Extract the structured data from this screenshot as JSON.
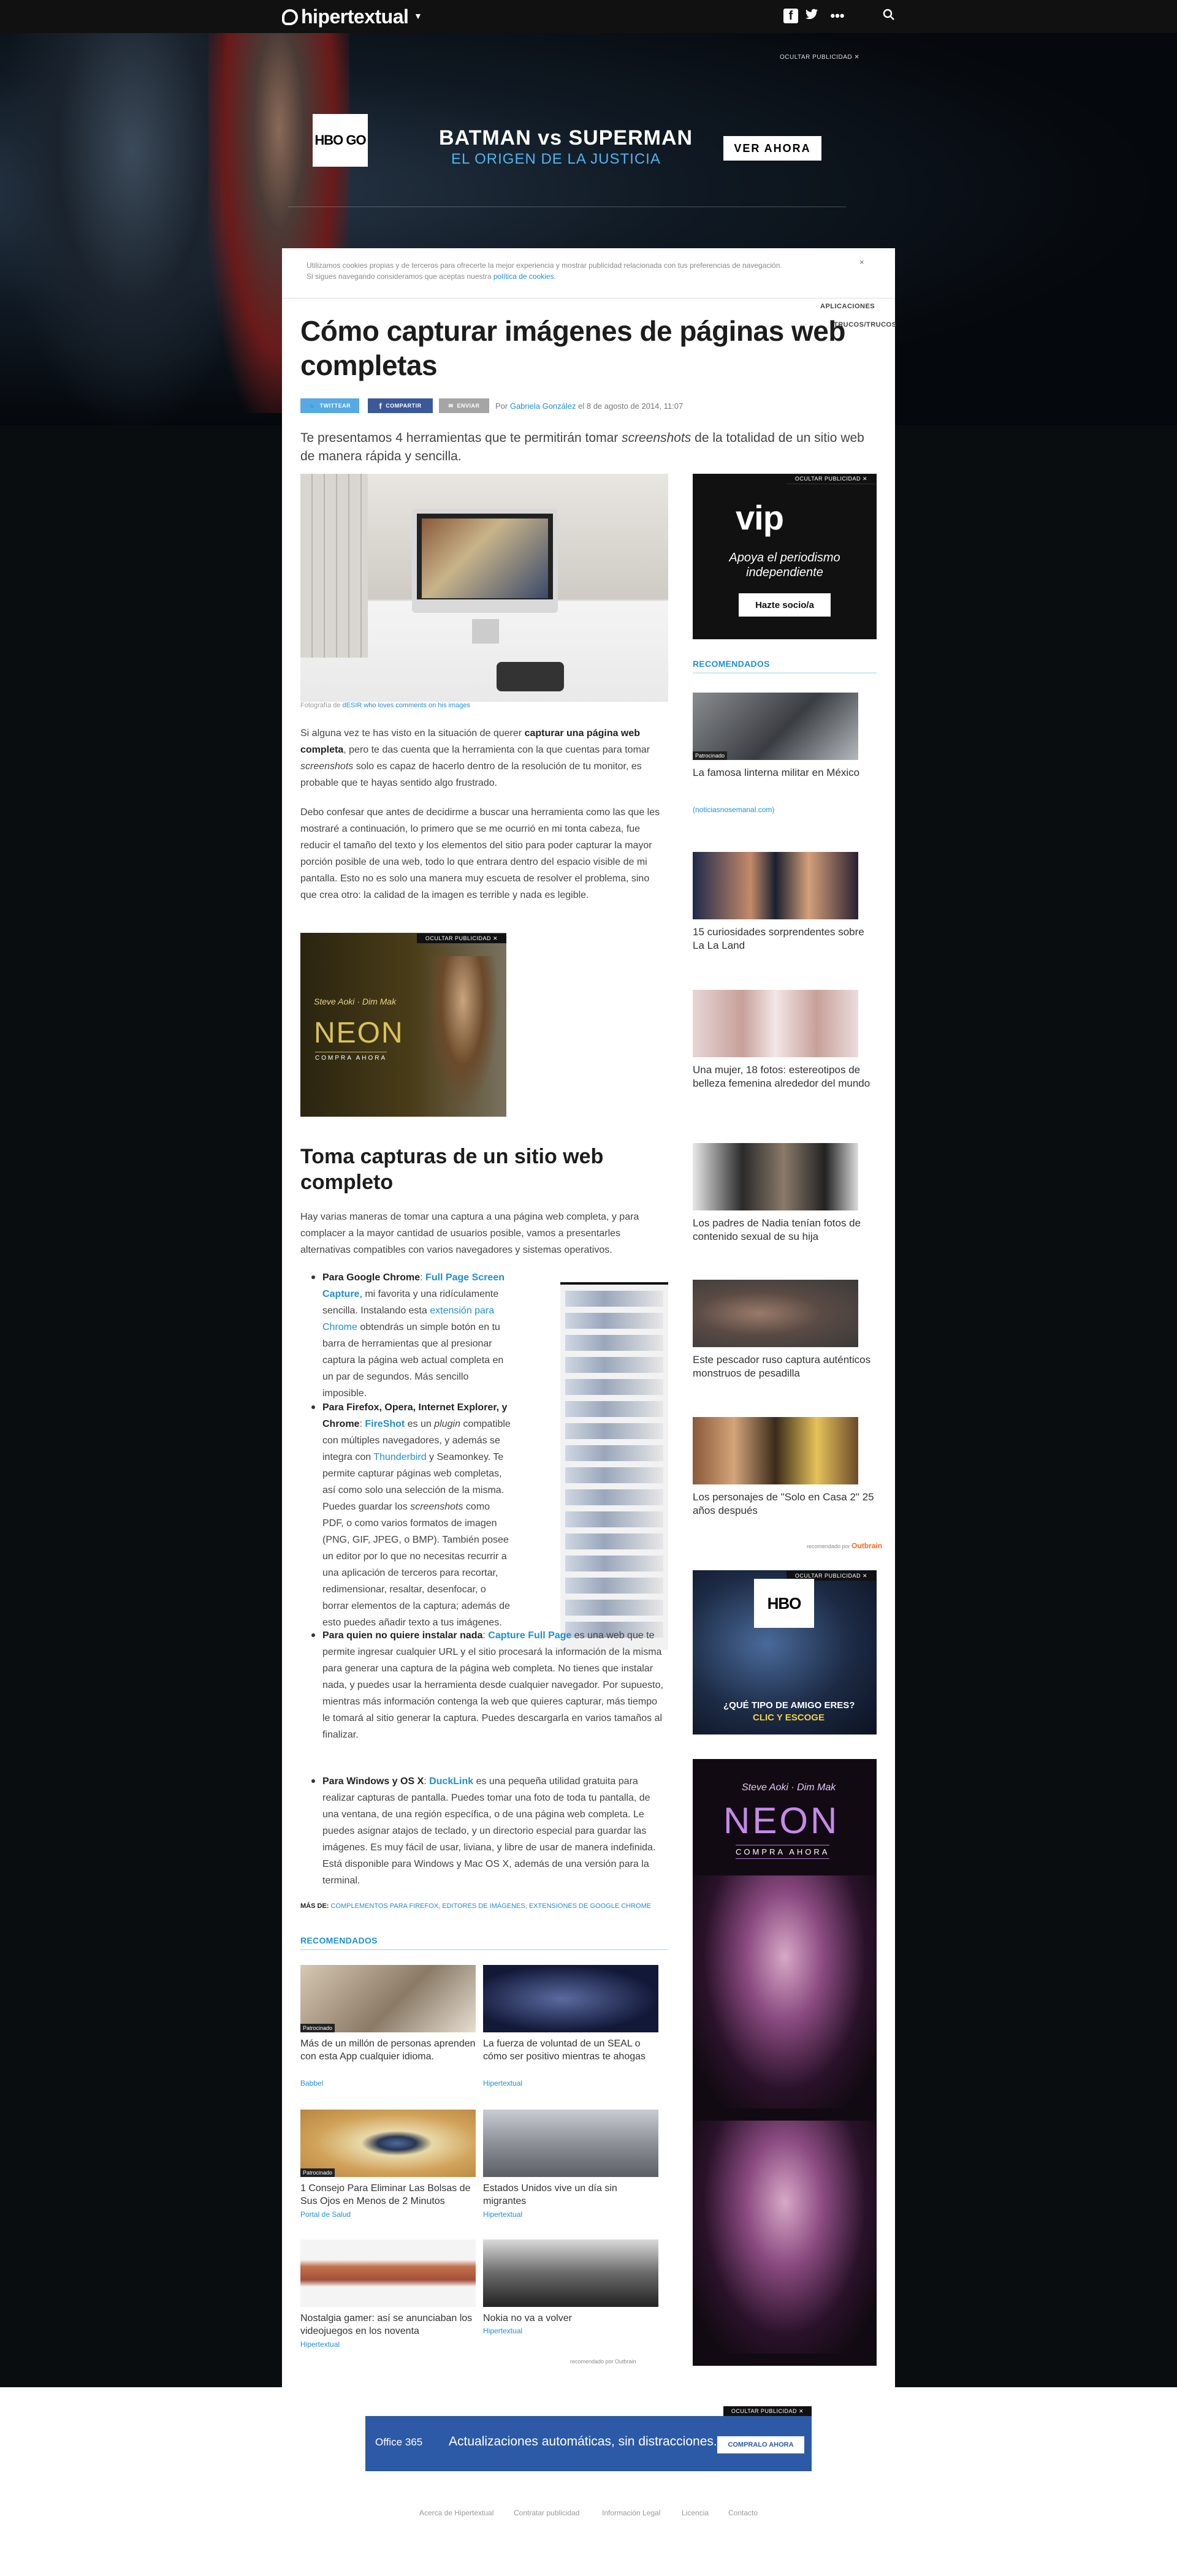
{
  "header": {
    "logo": "hipertextual",
    "icons": [
      "facebook-icon",
      "twitter-icon",
      "more-icon",
      "search-icon"
    ]
  },
  "hero_ad": {
    "hide_label": "OCULTAR PUBLICIDAD  ✕",
    "hbo_label": "HBO GO",
    "title": "BATMAN vs SUPERMAN",
    "subtitle": "EL ORIGEN DE LA JUSTICIA",
    "cta": "VER AHORA"
  },
  "cookie": {
    "text_1": "Utilizamos cookies propias y de terceros para ofrecerte la mejor experiencia y mostrar publicidad relacionada con tus preferencias de navegación.",
    "text_2": "Si sigues navegando consideramos que aceptas nuestra ",
    "link": "política de cookies",
    "close": "×"
  },
  "categories": [
    "APLICACIONES",
    "TRUCOS/TRUCOS"
  ],
  "article": {
    "title": "Cómo capturar imágenes de páginas web completas",
    "share": {
      "twitter": "TWITTEAR",
      "facebook": "COMPARTIR",
      "mail": "ENVIAR"
    },
    "byline_prefix": "Por ",
    "author": "Gabriela González",
    "byline_suffix": " el 8 de agosto de 2014, 11:07",
    "lede_1": "Te presentamos 4 herramientas que te permitirán tomar ",
    "lede_em": "screenshots",
    "lede_2": " de la totalidad de un sitio web de manera rápida y sencilla.",
    "caption_prefix": "Fotografía de ",
    "caption_link": "dESIR who loves comments on his images",
    "p1_a": "Si alguna vez te has visto en la situación de querer ",
    "p1_b": "capturar una página web completa",
    "p1_c": ", pero te das cuenta que la herramienta con la que cuentas para tomar ",
    "p1_d": "screenshots",
    "p1_e": " solo es capaz de hacerlo dentro de la resolución de tu monitor, es probable que te hayas sentido algo frustrado.",
    "p2": "Debo confesar que antes de decidirme a buscar una herramienta como las que les mostraré a continuación, lo primero que se me ocurrió en mi tonta cabeza, fue reducir el tamaño del texto y los elementos del sitio para poder capturar la mayor porción posible de una web, todo lo que entrara dentro del espacio visible de mi pantalla. Esto no es solo una manera muy escueta de resolver el problema, sino que crea otro: la calidad de la imagen es terrible y nada es legible.",
    "h2": "Toma capturas de un sitio web completo",
    "p3": "Hay varias maneras de tomar una captura a una página web completa, y para complacer a la mayor cantidad de usuarios posible, vamos a presentarles alternativas compatibles con varios navegadores y sistemas operativos.",
    "b1_a": "Para Google Chrome",
    "b1_link": "Full Page Screen Capture",
    "b1_b": ", mi favorita y una ridículamente sencilla. Instalando esta ",
    "b1_link2": "extensión para Chrome",
    "b1_c": " obtendrás un simple botón en tu barra de herramientas que al presionar captura la página web actual completa en un par de segundos. Más sencillo imposible.",
    "b2_a": "Para Firefox, Opera, Internet Explorer, y Chrome",
    "b2_link": "FireShot",
    "b2_b": " es un ",
    "b2_em": "plugin",
    "b2_c": " compatible con múltiples navegadores, y además se integra con ",
    "b2_link2": "Thunderbird",
    "b2_d": " y Seamonkey. Te permite capturar páginas web completas, así como solo una selección de la misma. Puedes guardar los ",
    "b2_em2": "screenshots",
    "b2_e": " como PDF, o como varios formatos de imagen (PNG, GIF, JPEG, o BMP). También posee un editor por lo que no necesitas recurrir a una aplicación de terceros para recortar, redimensionar, resaltar, desenfocar, o borrar elementos de la captura; además de esto puedes añadir texto a tus imágenes.",
    "b3_a": "Para quien no quiere instalar nada",
    "b3_link": "Capture Full Page",
    "b3_b": " es una web que te permite ingresar cualquier URL y el sitio procesará la información de la misma para generar una captura de la página web completa. No tienes que instalar nada, y puedes usar la herramienta desde cualquier navegador. Por supuesto, mientras más información contenga la web que quieres capturar, más tiempo le tomará al sitio generar la captura. Puedes descargarla en varios tamaños al finalizar.",
    "b4_a": "Para Windows y OS X",
    "b4_link": "DuckLink",
    "b4_b": " es una pequeña utilidad gratuita para realizar capturas de pantalla. Puedes tomar una foto de toda tu pantalla, de una ventana, de una región específica, o de una página web completa. Le puedes asignar atajos de teclado, y un directorio especial para guardar las imágenes. Es muy fácil de usar, liviana, y libre de usar de manera indefinida. Está disponible para Windows y Mac OS X, además de una versión para la terminal.",
    "tags_label": "MÁS DE: ",
    "tags": "COMPLEMENTOS PARA FIREFOX, EDITORES DE IMÁGENES, EXTENSIONES DE GOOGLE CHROME"
  },
  "ad_small": {
    "hide_label": "OCULTAR PUBLICIDAD  ✕",
    "brand": "Steve Aoki · Dim Mak",
    "title": "NEON",
    "cta": "COMPRA AHORA"
  },
  "rec_bottom": {
    "heading": "RECOMENDADOS",
    "items": [
      {
        "title": "Más de un millón de personas aprenden con esta App cualquier idioma.",
        "source": "Babbel",
        "badge": "Patrocinado"
      },
      {
        "title": "La fuerza de voluntad de un SEAL o cómo ser positivo mientras te ahogas",
        "source": "Hipertextual",
        "badge": ""
      },
      {
        "title": "1 Consejo Para Eliminar Las Bolsas de Sus Ojos en Menos de 2 Minutos",
        "source": "Portal de Salud",
        "badge": "Patrocinado"
      },
      {
        "title": "Estados Unidos vive un día sin migrantes",
        "source": "Hipertextual",
        "badge": ""
      },
      {
        "title": "Nostalgia gamer: así se anunciaban los videojuegos en los noventa",
        "source": "Hipertextual",
        "badge": ""
      },
      {
        "title": "Nokia no va a volver",
        "source": "Hipertextual",
        "badge": ""
      }
    ],
    "footer": "recomendado por Outbrain"
  },
  "sidebar": {
    "vip_ad": {
      "hide_label": "OCULTAR PUBLICIDAD  ✕",
      "logo": "vip",
      "text": "Apoya el periodismo independiente",
      "cta": "Hazte socio/a"
    },
    "rec_heading": "RECOMENDADOS",
    "items": [
      {
        "title": "La famosa linterna militar en México",
        "source": "(noticiasnosemanal.com)",
        "badge": "Patrocinado"
      },
      {
        "title": "15 curiosidades sorprendentes sobre La La Land",
        "source": "",
        "badge": ""
      },
      {
        "title": "Una mujer, 18 fotos: estereotipos de belleza femenina alrededor del mundo",
        "source": "",
        "badge": ""
      },
      {
        "title": "Los padres de Nadia tenían fotos de contenido sexual de su hija",
        "source": "",
        "badge": ""
      },
      {
        "title": "Este pescador ruso captura auténticos monstruos de pesadilla",
        "source": "",
        "badge": ""
      },
      {
        "title": "Los personajes de \"Solo en Casa 2\" 25 años después",
        "source": "",
        "badge": ""
      }
    ],
    "outbrain_label": "recomendado por ",
    "outbrain_brand": "Outbrain",
    "hbo_ad": {
      "hide_label": "OCULTAR PUBLICIDAD  ✕",
      "logo": "HBO",
      "question": "¿QUÉ TIPO DE AMIGO ERES?",
      "cta": "CLIC Y ESCOGE"
    },
    "neon_ad": {
      "brand": "Steve Aoki · Dim Mak",
      "title": "NEON",
      "cta": "COMPRA AHORA"
    }
  },
  "footer": {
    "ad": {
      "hide_label": "OCULTAR PUBLICIDAD  ✕",
      "logo": "Office 365",
      "text": "Actualizaciones automáticas, sin distracciones.",
      "cta": "COMPRALO AHORA"
    },
    "links": [
      "Acerca de Hipertextual",
      "Contratar publicidad",
      "Información Legal",
      "Licencia",
      "Contacto"
    ]
  },
  "colors": {
    "accent": "#1f8fd6",
    "twitter": "#56a9e4",
    "facebook": "#3b5998",
    "office": "#2d5aa6"
  }
}
